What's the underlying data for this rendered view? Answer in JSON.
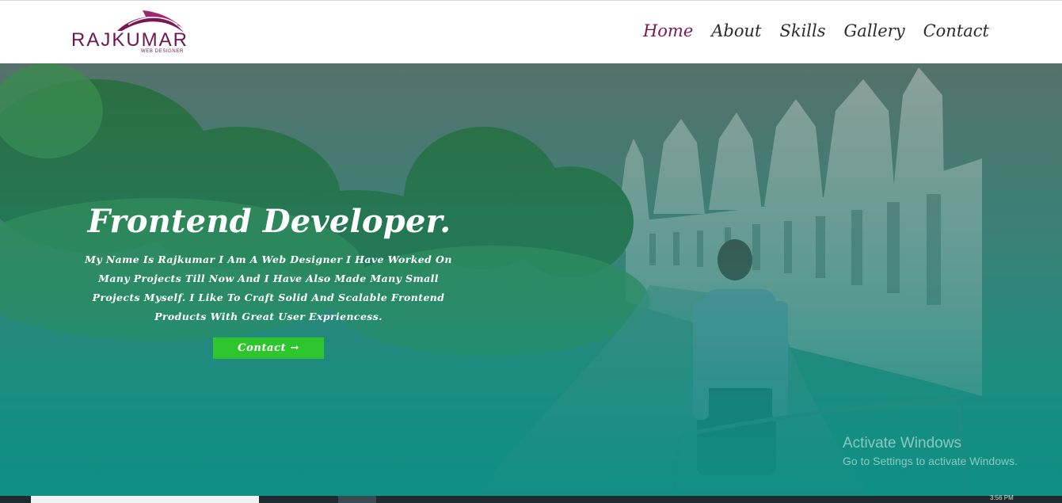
{
  "brand": {
    "name": "RAJKUMAR",
    "tagline": "WEB DESIGNER",
    "color": "#6d1550"
  },
  "nav": {
    "items": [
      {
        "label": "Home",
        "active": true
      },
      {
        "label": "About",
        "active": false
      },
      {
        "label": "Skills",
        "active": false
      },
      {
        "label": "Gallery",
        "active": false
      },
      {
        "label": "Contact",
        "active": false
      }
    ],
    "active_color": "#7b1654"
  },
  "hero": {
    "title": "Frontend Developer.",
    "description": "My Name Is Rajkumar I Am A Web Designer I Have Worked On Many Projects Till Now And I Have Also Made Many Small Projects Myself. I Like To Craft Solid And Scalable Frontend Products With Great User Expriencess.",
    "button_label": "Contact →",
    "button_color": "#2ec52f",
    "overlay_color": "#0f8f84"
  },
  "watermark": {
    "line1": "Activate Windows",
    "line2": "Go to Settings to activate Windows."
  },
  "taskbar": {
    "time": "3:56 PM"
  }
}
